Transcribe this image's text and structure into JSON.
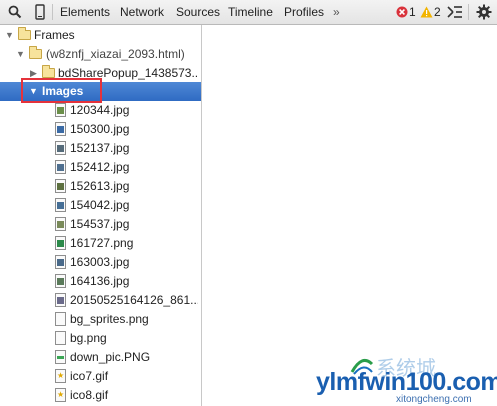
{
  "toolbar": {
    "tabs": [
      "Elements",
      "Network",
      "Sources",
      "Timeline",
      "Profiles"
    ],
    "more": "»",
    "errors": "1",
    "warnings": "2",
    "icons": [
      "search-icon",
      "device-mode-icon",
      "error-icon",
      "warning-icon",
      "console-drawer-icon",
      "settings-gear-icon"
    ]
  },
  "tree": {
    "frames_label": "Frames",
    "frame_label": "(w8znfj_xiazai_2093.html)",
    "popup_label": "bdSharePopup_1438573...",
    "images_label": "Images",
    "images": [
      "120344.jpg",
      "150300.jpg",
      "152137.jpg",
      "152412.jpg",
      "152613.jpg",
      "154042.jpg",
      "154537.jpg",
      "161727.png",
      "163003.jpg",
      "164136.jpg",
      "20150525164126_861...",
      "bg_sprites.png",
      "bg.png",
      "down_pic.PNG",
      "ico7.gif",
      "ico8.gif"
    ]
  },
  "watermark": {
    "brand": "ylmfwin100.com",
    "site": "xitongcheng.com",
    "chinese": "系统城"
  },
  "colors": {
    "selection": "#3d78cf",
    "highlight_box": "#e5323b",
    "error": "#d9323b",
    "warning": "#f2b400",
    "watermark_blue": "#1a6fc0"
  }
}
